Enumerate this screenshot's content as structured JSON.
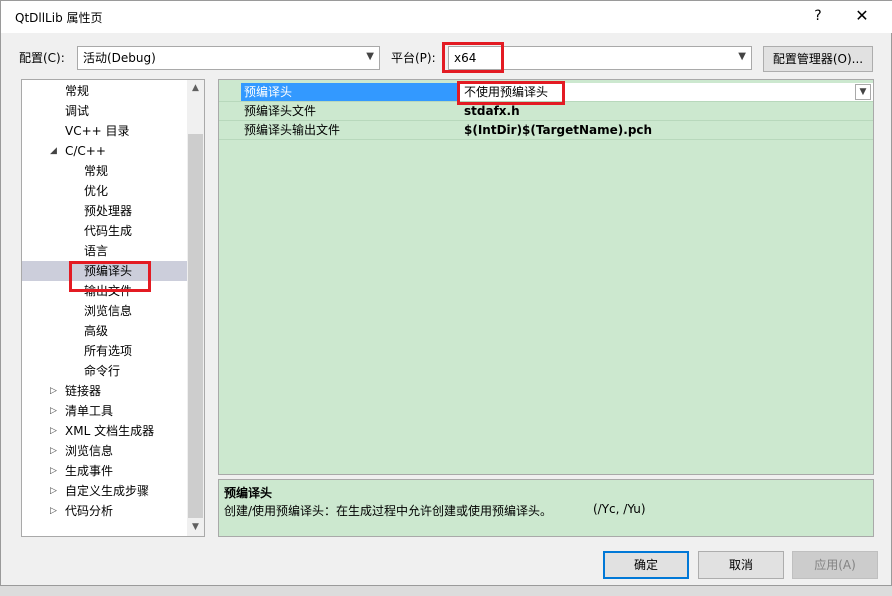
{
  "window": {
    "title": "QtDllLib 属性页",
    "help_icon": "?",
    "close_icon": "✕"
  },
  "config": {
    "label": "配置(C):",
    "value": "活动(Debug)",
    "platform_label": "平台(P):",
    "platform_value": "x64",
    "manager_button": "配置管理器(O)..."
  },
  "tree": {
    "items": [
      {
        "label": "常规",
        "level": 1
      },
      {
        "label": "调试",
        "level": 1
      },
      {
        "label": "VC++ 目录",
        "level": 1
      },
      {
        "label": "C/C++",
        "level": 0,
        "expander": "expanded"
      },
      {
        "label": "常规",
        "level": 2
      },
      {
        "label": "优化",
        "level": 2
      },
      {
        "label": "预处理器",
        "level": 2
      },
      {
        "label": "代码生成",
        "level": 2
      },
      {
        "label": "语言",
        "level": 2
      },
      {
        "label": "预编译头",
        "level": 2,
        "selected": true
      },
      {
        "label": "输出文件",
        "level": 2
      },
      {
        "label": "浏览信息",
        "level": 2
      },
      {
        "label": "高级",
        "level": 2
      },
      {
        "label": "所有选项",
        "level": 2
      },
      {
        "label": "命令行",
        "level": 2
      },
      {
        "label": "链接器",
        "level": 0,
        "expander": "collapsed"
      },
      {
        "label": "清单工具",
        "level": 0,
        "expander": "collapsed"
      },
      {
        "label": "XML 文档生成器",
        "level": 0,
        "expander": "collapsed"
      },
      {
        "label": "浏览信息",
        "level": 0,
        "expander": "collapsed"
      },
      {
        "label": "生成事件",
        "level": 0,
        "expander": "collapsed"
      },
      {
        "label": "自定义生成步骤",
        "level": 0,
        "expander": "collapsed"
      },
      {
        "label": "代码分析",
        "level": 0,
        "expander": "collapsed"
      }
    ]
  },
  "grid": {
    "rows": [
      {
        "name": "预编译头",
        "value": "不使用预编译头",
        "selected": true
      },
      {
        "name": "预编译头文件",
        "value": "stdafx.h"
      },
      {
        "name": "预编译头输出文件",
        "value": "$(IntDir)$(TargetName).pch"
      }
    ]
  },
  "description": {
    "title": "预编译头",
    "text": "创建/使用预编译头：在生成过程中允许创建或使用预编译头。",
    "switches": "(/Yc, /Yu)"
  },
  "buttons": {
    "ok": "确定",
    "cancel": "取消",
    "apply": "应用(A)"
  },
  "colors": {
    "grid_bg": "#cce8cf",
    "selection": "#3399ff",
    "highlight": "#e31b23",
    "tree_selection": "#cccedb"
  }
}
